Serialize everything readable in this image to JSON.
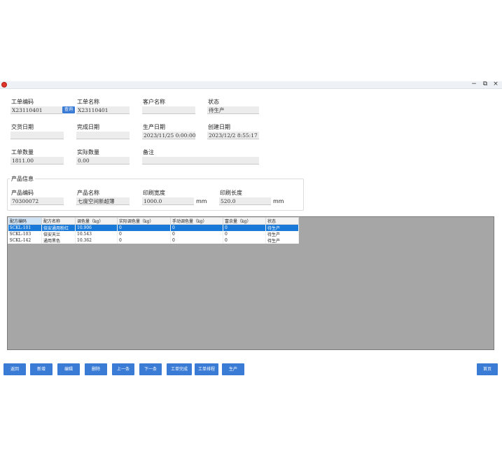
{
  "window": {
    "minimize": "−",
    "maximize": "⧉",
    "close": "×"
  },
  "order": {
    "code_label": "工单编码",
    "code_value": "X23110401",
    "query_label": "查询",
    "name_label": "工单名称",
    "name_value": "X23110401",
    "customer_label": "客户名称",
    "customer_value": "",
    "status_label": "状态",
    "status_value": "待生产",
    "delivery_label": "交货日期",
    "delivery_value": "",
    "complete_label": "完成日期",
    "complete_value": "",
    "produce_label": "生产日期",
    "produce_value": "2023/11/25 0:00:00",
    "create_label": "创建日期",
    "create_value": "2023/12/2 8:55:17",
    "qty_label": "工单数量",
    "qty_value": "1811.00",
    "actual_label": "实际数量",
    "actual_value": "0.00",
    "remark_label": "备注",
    "remark_value": ""
  },
  "product": {
    "group_title": "产品信息",
    "code_label": "产品编码",
    "code_value": "70300072",
    "name_label": "产品名称",
    "name_value": "七度空间新超薄",
    "width_label": "印刷宽度",
    "width_value": "1000.0",
    "width_unit": "mm",
    "length_label": "印刷长度",
    "length_value": "520.0",
    "length_unit": "mm"
  },
  "grid": {
    "columns": [
      "配方编码",
      "配方名称",
      "调色量（kg）",
      "实际调色量（kg）",
      "手动调色量（kg）",
      "富余量（kg）",
      "状态"
    ],
    "rows": [
      [
        "SCKL-101",
        "倍安通用粉红",
        "10.906",
        "0",
        "0",
        "0",
        "待生产"
      ],
      [
        "SCKL-103",
        "倍安天兰",
        "10.543",
        "0",
        "0",
        "0",
        "待生产"
      ],
      [
        "SCKL-142",
        "通用黑色",
        "10.362",
        "0",
        "0",
        "0",
        "待生产"
      ]
    ]
  },
  "buttons": {
    "back": "返回",
    "add": "新增",
    "edit": "编辑",
    "delete": "删除",
    "prev": "上一条",
    "next": "下一条",
    "finish": "工单完成",
    "schedule": "工单排程",
    "produce": "生产",
    "home": "首页"
  },
  "colors": {
    "accent": "#3a7bd5",
    "selected_row": "#1979d8",
    "grid_background": "#a6a6a6"
  }
}
